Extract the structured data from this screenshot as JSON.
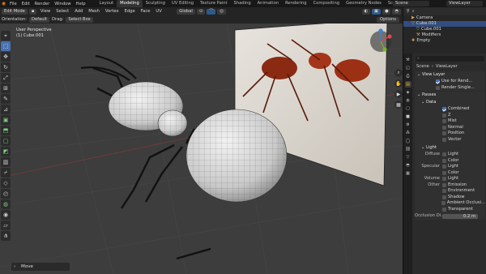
{
  "topbar": {
    "menus": [
      "File",
      "Edit",
      "Render",
      "Window",
      "Help"
    ],
    "workspaces": [
      "Layout",
      "Modeling",
      "Sculpting",
      "UV Editing",
      "Texture Paint",
      "Shading",
      "Animation",
      "Rendering",
      "Compositing",
      "Geometry Nodes",
      "Scripting"
    ],
    "active_workspace": "Modeling",
    "scene": "Scene",
    "view_layer": "ViewLayer"
  },
  "header": {
    "mode": "Edit Mode",
    "menus": [
      "View",
      "Select",
      "Add",
      "Mesh",
      "Vertex",
      "Edge",
      "Face",
      "UV"
    ],
    "transform_orientation": "Global",
    "orientation_label": "Orientation:",
    "orientation_value": "Default",
    "drag_label": "Drag:",
    "drag_value": "Select Box",
    "options": "Options"
  },
  "viewport": {
    "info_line1": "User Perspective",
    "info_line2": "(1) Cube.001",
    "last_op": "Move"
  },
  "toolbar": {
    "icons": [
      "cursor-icon",
      "select-box-icon",
      "move-icon",
      "rotate-icon",
      "scale-icon",
      "transform-icon",
      "annotate-icon",
      "measure-icon",
      "add-cube-icon",
      "extrude-icon",
      "inset-icon",
      "bevel-icon",
      "loop-cut-icon",
      "knife-icon",
      "poly-build-icon",
      "spin-icon",
      "smooth-icon",
      "shrink-icon",
      "shear-icon",
      "rip-icon"
    ]
  },
  "outliner": {
    "rows": [
      {
        "label": "Camera",
        "icon": "camera-icon",
        "selected": false
      },
      {
        "label": "Cube.001",
        "icon": "mesh-icon",
        "selected": true
      },
      {
        "label": "Cube.001",
        "icon": "mesh-data-icon",
        "selected": false
      },
      {
        "label": "Modifiers",
        "icon": "wrench-icon",
        "selected": false
      },
      {
        "label": "Empty",
        "icon": "empty-icon",
        "selected": false
      }
    ]
  },
  "properties": {
    "breadcrumb": [
      "Scene",
      "ViewLayer"
    ],
    "view_layer_panel": "View Layer",
    "use_for_rendering": "Use for Rend...",
    "render_single_layer": "Render Single...",
    "passes_panel": "Passes",
    "data_panel": "Data",
    "data_passes": [
      {
        "label": "Combined",
        "checked": true
      },
      {
        "label": "Z",
        "checked": false
      },
      {
        "label": "Mist",
        "checked": false
      },
      {
        "label": "Normal",
        "checked": false
      },
      {
        "label": "Position",
        "checked": false
      },
      {
        "label": "Vector",
        "checked": false
      }
    ],
    "light_panel": "Light",
    "diffuse_label": "Diffuse",
    "specular_label": "Specular",
    "volume_label": "Volume",
    "other_label": "Other",
    "light_label": "Light",
    "color_label": "Color",
    "other_passes": [
      "Emission",
      "Environment",
      "Shadow",
      "Ambient Occlusi...",
      "Transparent"
    ],
    "occlusion_label": "Occlusion Di...",
    "occlusion_value": "0.2 m"
  },
  "colors": {
    "accent": "#4772b3",
    "viewport_bg": "#3d3d3d",
    "panel_bg": "#2b2b2b"
  }
}
